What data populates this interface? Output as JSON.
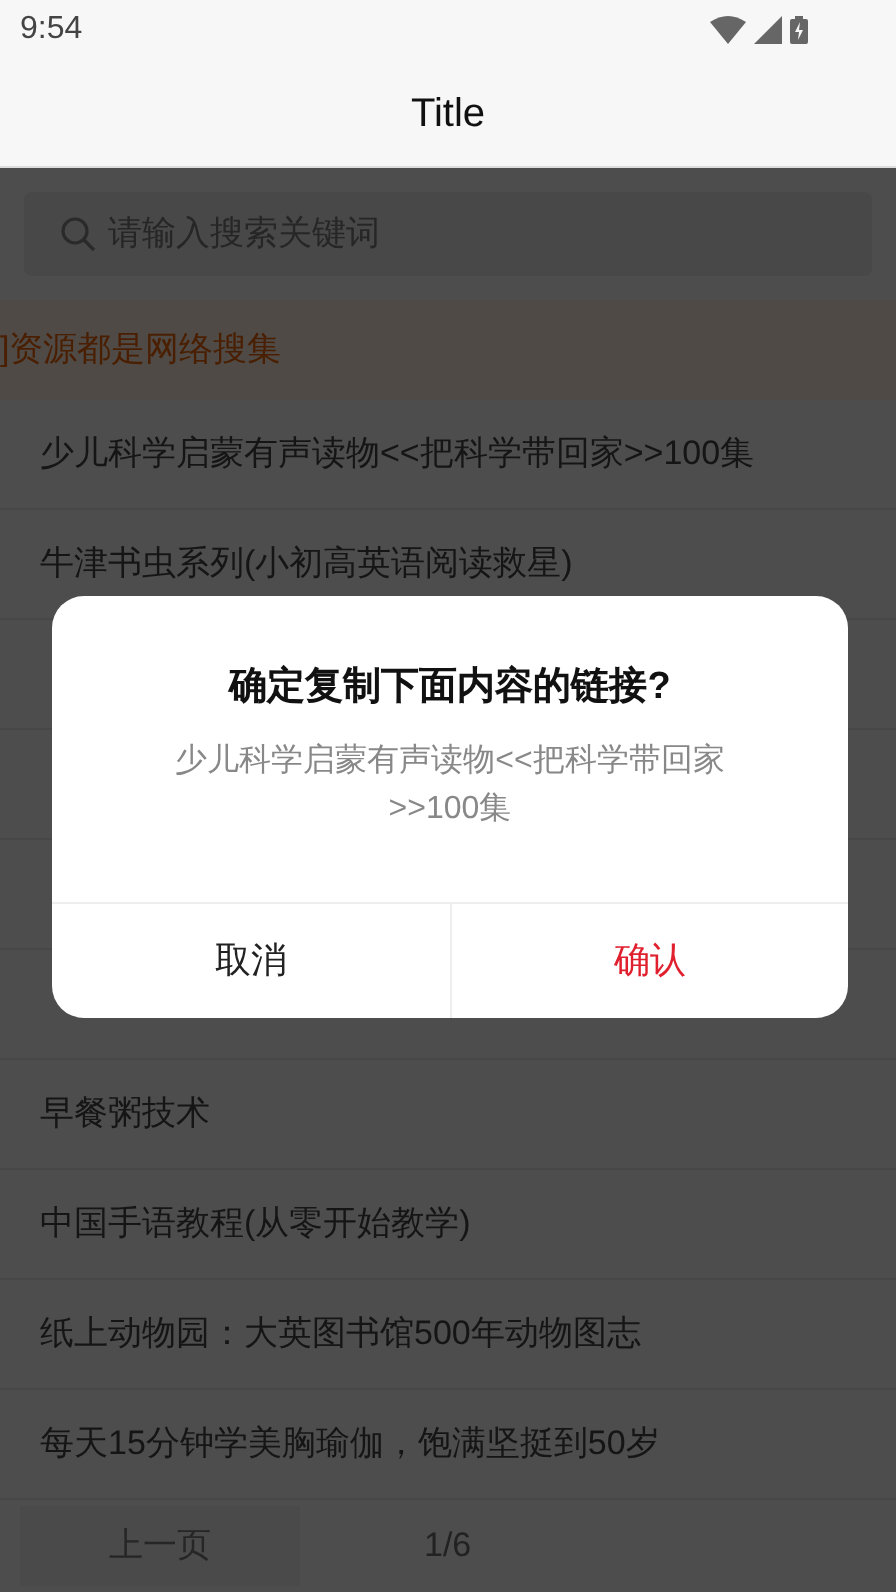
{
  "status_bar": {
    "time": "9:54"
  },
  "app_bar": {
    "title": "Title"
  },
  "search": {
    "placeholder": "请输入搜索关键词"
  },
  "notice": "]资源都是网络搜集",
  "list": {
    "items_above": [
      "少儿科学启蒙有声读物<<把科学带回家>>100集",
      "牛津书虫系列(小初高英语阅读救星)"
    ],
    "items_below": [
      "早餐粥技术",
      "中国手语教程(从零开始教学)",
      "纸上动物园：大英图书馆500年动物图志",
      "每天15分钟学美胸瑜伽，饱满坚挺到50岁"
    ]
  },
  "pagination": {
    "prev": "上一页",
    "page": "1/6"
  },
  "dialog": {
    "title": "确定复制下面内容的链接?",
    "message": "少儿科学启蒙有声读物<<把科学带回家>>100集",
    "buttons": [
      {
        "label": "取消",
        "kind": "cancel"
      },
      {
        "label": "确认",
        "kind": "confirm"
      }
    ]
  }
}
